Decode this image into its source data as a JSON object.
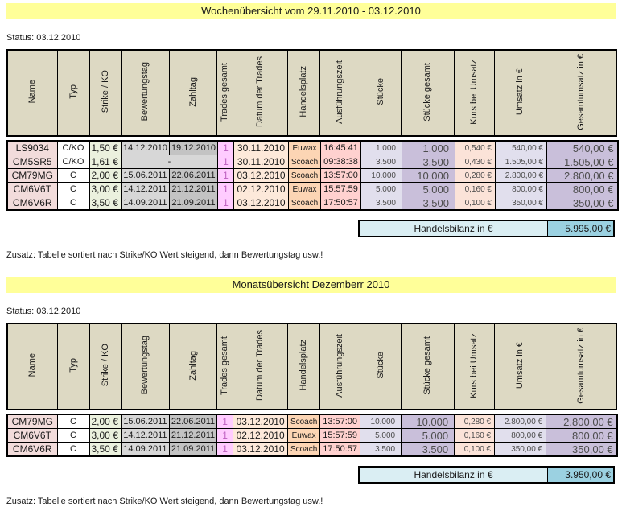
{
  "columns": [
    "Name",
    "Typ",
    "Strike / KO",
    "Bewertungstag",
    "Zahltag",
    "Trades gesamt",
    "Datum der Trades",
    "Handelsplatz",
    "Ausführungszeit",
    "Stücke",
    "Stücke gesamt",
    "Kurs bei Umsatz",
    "Umsatz in €",
    "Gesamtumsatz in €"
  ],
  "tables": [
    {
      "title": "Wochenübersicht vom 29.11.2010 - 03.12.2010",
      "status": "Status: 03.12.2010",
      "rows": [
        {
          "merge_dates": false,
          "cells": [
            "LS9034",
            "C/KO",
            "1,50 €",
            "14.12.2010",
            "19.12.2010",
            "1",
            "30.11.2010",
            "Euwax",
            "16:45:41",
            "1.000",
            "1.000",
            "0,540 €",
            "540,00 €",
            "540,00 €"
          ]
        },
        {
          "merge_dates": true,
          "cells": [
            "CM5SR5",
            "C/KO",
            "1,61 €",
            "-",
            null,
            "1",
            "30.11.2010",
            "Scoach",
            "09:38:38",
            "3.500",
            "3.500",
            "0,430 €",
            "1.505,00 €",
            "1.505,00 €"
          ]
        },
        {
          "merge_dates": false,
          "cells": [
            "CM79MG",
            "C",
            "2,00 €",
            "15.06.2011",
            "22.06.2011",
            "1",
            "03.12.2010",
            "Scoach",
            "13:57:00",
            "10.000",
            "10.000",
            "0,280 €",
            "2.800,00 €",
            "2.800,00 €"
          ]
        },
        {
          "merge_dates": false,
          "cells": [
            "CM6V6T",
            "C",
            "3,00 €",
            "14.12.2011",
            "21.12.2011",
            "1",
            "02.12.2010",
            "Euwax",
            "15:57:59",
            "5.000",
            "5.000",
            "0,160 €",
            "800,00 €",
            "800,00 €"
          ]
        },
        {
          "merge_dates": false,
          "cells": [
            "CM6V6R",
            "C",
            "3,50 €",
            "14.09.2011",
            "21.09.2011",
            "1",
            "03.12.2010",
            "Scoach",
            "17:50:57",
            "3.500",
            "3.500",
            "0,100 €",
            "350,00 €",
            "350,00 €"
          ]
        }
      ],
      "balance_label": "Handelsbilanz in €",
      "balance_value": "5.995,00 €",
      "footnote": "Zusatz: Tabelle sortiert nach Strike/KO Wert steigend, dann Bewertungstag usw.!"
    },
    {
      "title": "Monatsübersicht Dezemberr 2010",
      "status": "Status: 03.12.2010",
      "rows": [
        {
          "merge_dates": false,
          "cells": [
            "CM79MG",
            "C",
            "2,00 €",
            "15.06.2011",
            "22.06.2011",
            "1",
            "03.12.2010",
            "Scoach",
            "13:57:00",
            "10.000",
            "10.000",
            "0,280 €",
            "2.800,00 €",
            "2.800,00 €"
          ]
        },
        {
          "merge_dates": false,
          "cells": [
            "CM6V6T",
            "C",
            "3,00 €",
            "14.12.2011",
            "21.12.2011",
            "1",
            "02.12.2010",
            "Euwax",
            "15:57:59",
            "5.000",
            "5.000",
            "0,160 €",
            "800,00 €",
            "800,00 €"
          ]
        },
        {
          "merge_dates": false,
          "cells": [
            "CM6V6R",
            "C",
            "3,50 €",
            "14.09.2011",
            "21.09.2011",
            "1",
            "03.12.2010",
            "Scoach",
            "17:50:57",
            "3.500",
            "3.500",
            "0,100 €",
            "350,00 €",
            "350,00 €"
          ]
        }
      ],
      "balance_label": "Handelsbilanz in €",
      "balance_value": "3.950,00 €",
      "footnote": "Zusatz: Tabelle sortiert nach Strike/KO Wert steigend, dann Bewertungstag usw.!"
    }
  ],
  "colors": {
    "title_bg": "#FFFF99",
    "header_bg": "#DDD9C3",
    "name_bg": "#F2DCDB",
    "strike_bg": "#EBF1DE",
    "bewertung_bg": "#D7D7D7",
    "zahltag_bg": "#C3C3C3",
    "trades_bg": "#FFCCFF",
    "trades_text": "#BD5FBF",
    "datum_bg": "#FDE9DA",
    "platz_bg": "#FCD5B4",
    "zeit_bg": "#FFD1CF",
    "stueck_bg": "#E1DFED",
    "stueck_gesamt_bg": "#C9BFDA",
    "kurs_bg": "#FBE3D8",
    "balance_label_bg": "#DAEEF3",
    "balance_value_bg": "#9BD1E1"
  }
}
